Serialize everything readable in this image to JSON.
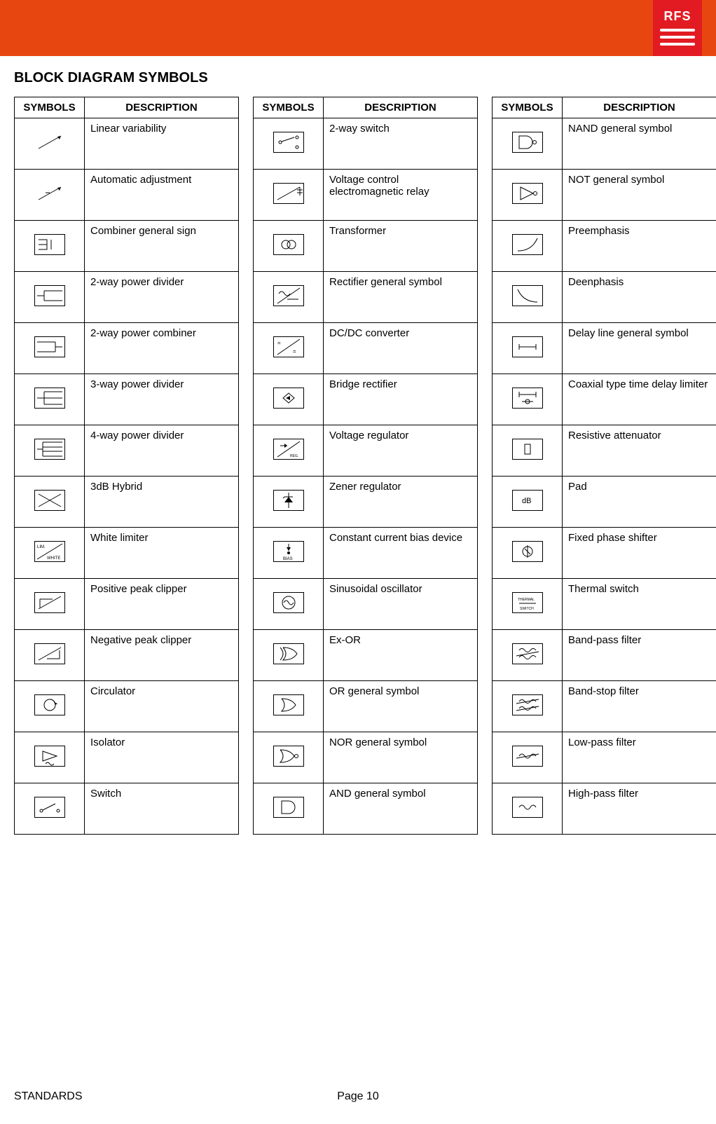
{
  "logo": "RFS",
  "title": "BLOCK DIAGRAM SYMBOLS",
  "headers": {
    "symbols": "SYMBOLS",
    "description": "DESCRIPTION"
  },
  "columns": [
    [
      {
        "desc": "Linear variability",
        "sym": "linear-variability"
      },
      {
        "desc": "Automatic adjustment",
        "sym": "automatic-adjustment"
      },
      {
        "desc": "Combiner general sign",
        "sym": "combiner-general"
      },
      {
        "desc": "2-way power divider",
        "sym": "2way-power-divider"
      },
      {
        "desc": "2-way power combiner",
        "sym": "2way-power-combiner"
      },
      {
        "desc": "3-way power divider",
        "sym": "3way-power-divider"
      },
      {
        "desc": "4-way power divider",
        "sym": "4way-power-divider"
      },
      {
        "desc": "3dB Hybrid",
        "sym": "3db-hybrid"
      },
      {
        "desc": "White limiter",
        "sym": "white-limiter"
      },
      {
        "desc": "Positive peak clipper",
        "sym": "positive-peak-clipper"
      },
      {
        "desc": "Negative peak clipper",
        "sym": "negative-peak-clipper"
      },
      {
        "desc": "Circulator",
        "sym": "circulator"
      },
      {
        "desc": "Isolator",
        "sym": "isolator"
      },
      {
        "desc": "Switch",
        "sym": "switch"
      }
    ],
    [
      {
        "desc": "2-way switch",
        "sym": "2way-switch"
      },
      {
        "desc": "Voltage control electromagnetic relay",
        "sym": "voltage-control-relay"
      },
      {
        "desc": "Transformer",
        "sym": "transformer"
      },
      {
        "desc": "Rectifier general symbol",
        "sym": "rectifier-general"
      },
      {
        "desc": "DC/DC converter",
        "sym": "dcdc-converter"
      },
      {
        "desc": "Bridge rectifier",
        "sym": "bridge-rectifier"
      },
      {
        "desc": "Voltage regulator",
        "sym": "voltage-regulator"
      },
      {
        "desc": "Zener regulator",
        "sym": "zener-regulator"
      },
      {
        "desc": "Constant current bias device",
        "sym": "constant-current-bias"
      },
      {
        "desc": "Sinusoidal oscillator",
        "sym": "sinusoidal-oscillator"
      },
      {
        "desc": "Ex-OR",
        "sym": "ex-or"
      },
      {
        "desc": "OR general symbol",
        "sym": "or-general"
      },
      {
        "desc": "NOR general symbol",
        "sym": "nor-general"
      },
      {
        "desc": "AND general symbol",
        "sym": "and-general"
      }
    ],
    [
      {
        "desc": "NAND general symbol",
        "sym": "nand-general"
      },
      {
        "desc": "NOT general symbol",
        "sym": "not-general"
      },
      {
        "desc": "Preemphasis",
        "sym": "preemphasis"
      },
      {
        "desc": "Deenphasis",
        "sym": "deenphasis"
      },
      {
        "desc": "Delay line general symbol",
        "sym": "delay-line"
      },
      {
        "desc": "Coaxial type time delay limiter",
        "sym": "coaxial-delay-limiter"
      },
      {
        "desc": "Resistive attenuator",
        "sym": "resistive-attenuator"
      },
      {
        "desc": "Pad",
        "sym": "pad"
      },
      {
        "desc": "Fixed phase shifter",
        "sym": "fixed-phase-shifter"
      },
      {
        "desc": "Thermal switch",
        "sym": "thermal-switch"
      },
      {
        "desc": "Band-pass filter",
        "sym": "band-pass-filter"
      },
      {
        "desc": "Band-stop filter",
        "sym": "band-stop-filter"
      },
      {
        "desc": "Low-pass filter",
        "sym": "low-pass-filter"
      },
      {
        "desc": "High-pass filter",
        "sym": "high-pass-filter"
      }
    ]
  ],
  "footer": {
    "left": "STANDARDS",
    "center": "Page 10"
  }
}
